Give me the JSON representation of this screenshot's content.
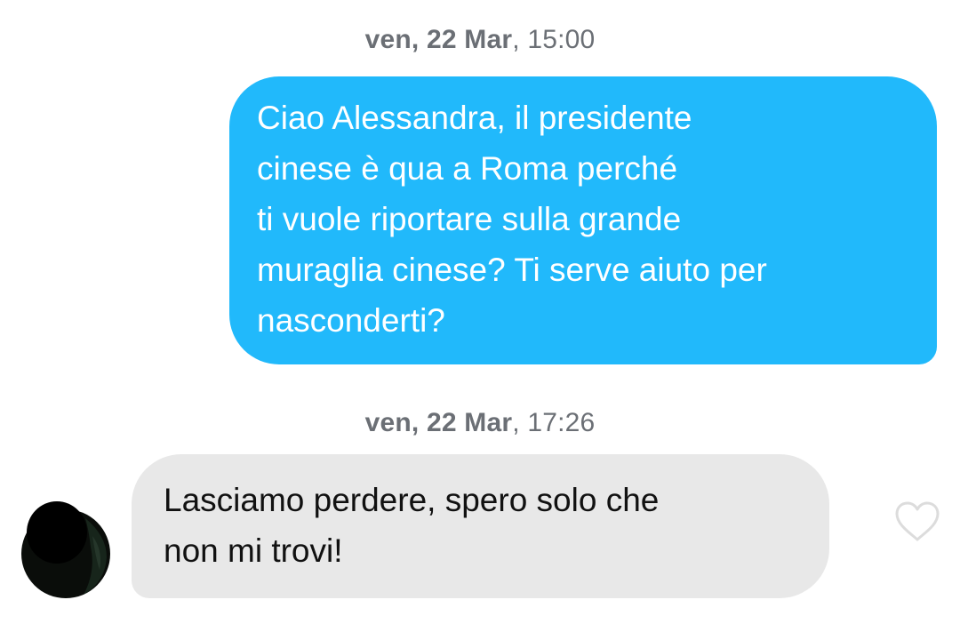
{
  "messages": [
    {
      "timestamp_day": "ven, 22 Mar",
      "timestamp_time": "15:00",
      "direction": "outgoing",
      "lines": [
        "Ciao Alessandra, il presidente",
        "cinese è qua a Roma perché",
        "ti vuole riportare sulla grande",
        "muraglia cinese? Ti serve aiuto per",
        "nasconderti?"
      ]
    },
    {
      "timestamp_day": "ven, 22 Mar",
      "timestamp_time": "17:26",
      "direction": "incoming",
      "lines": [
        "Lasciamo perdere, spero solo che",
        "non mi trovi!"
      ],
      "liked": false
    }
  ],
  "colors": {
    "outgoing_bubble": "#21b9fb",
    "incoming_bubble": "#e8e8e8",
    "timestamp_text": "#6b6f75",
    "like_icon_outline": "#dcdcdc"
  },
  "icons": {
    "avatar": "avatar",
    "like": "heart-outline-icon"
  }
}
